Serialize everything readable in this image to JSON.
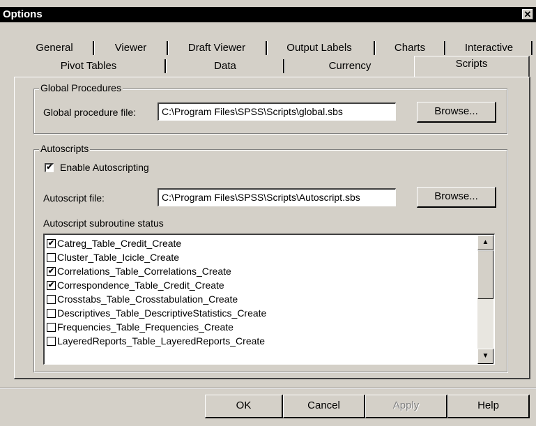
{
  "window": {
    "title": "Options",
    "close_label": "x"
  },
  "tabs_row1": [
    "General",
    "Viewer",
    "Draft Viewer",
    "Output Labels",
    "Charts",
    "Interactive"
  ],
  "tabs_row2": [
    "Pivot Tables",
    "Data",
    "Currency",
    "Scripts"
  ],
  "active_tab": "Scripts",
  "global_procedures": {
    "legend": "Global Procedures",
    "file_label": "Global procedure file:",
    "file_value": "C:\\Program Files\\SPSS\\Scripts\\global.sbs",
    "browse_label": "Browse..."
  },
  "autoscripts": {
    "legend": "Autoscripts",
    "enable_label": "Enable Autoscripting",
    "enable_checked": true,
    "file_label": "Autoscript file:",
    "file_value": "C:\\Program Files\\SPSS\\Scripts\\Autoscript.sbs",
    "browse_label": "Browse...",
    "status_label": "Autoscript subroutine status",
    "subroutines": [
      {
        "name": "Catreg_Table_Credit_Create",
        "checked": true
      },
      {
        "name": "Cluster_Table_Icicle_Create",
        "checked": false
      },
      {
        "name": "Correlations_Table_Correlations_Create",
        "checked": true
      },
      {
        "name": "Correspondence_Table_Credit_Create",
        "checked": true
      },
      {
        "name": "Crosstabs_Table_Crosstabulation_Create",
        "checked": false
      },
      {
        "name": "Descriptives_Table_DescriptiveStatistics_Create",
        "checked": false
      },
      {
        "name": "Frequencies_Table_Frequencies_Create",
        "checked": false
      },
      {
        "name": "LayeredReports_Table_LayeredReports_Create",
        "checked": false
      }
    ]
  },
  "footer": {
    "ok": "OK",
    "cancel": "Cancel",
    "apply": "Apply",
    "help": "Help",
    "apply_enabled": false
  },
  "icons": {
    "check": "✔",
    "up": "▲",
    "down": "▼",
    "close": "✕"
  }
}
